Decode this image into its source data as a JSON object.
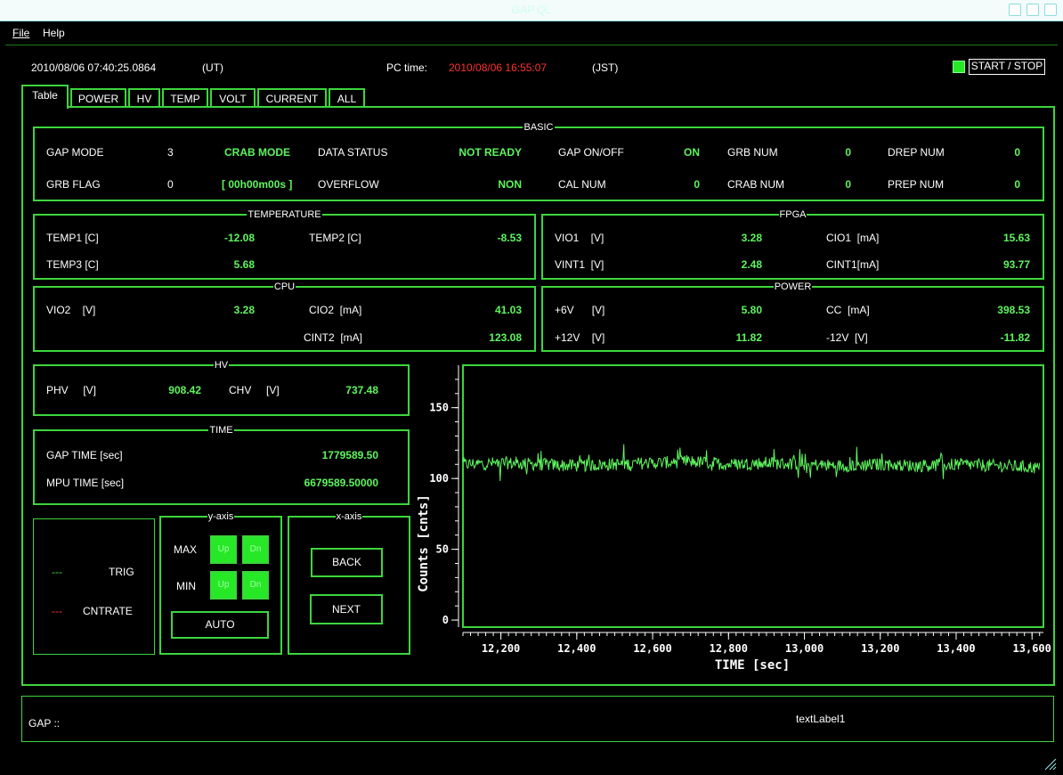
{
  "window": {
    "title": "GAP QL"
  },
  "menu": {
    "file": "File",
    "help": "Help"
  },
  "header": {
    "ut_time": "2010/08/06 07:40:25.0864",
    "ut_label": "(UT)",
    "pc_time_label": "PC time:",
    "pc_time": "2010/08/06 16:55:07",
    "jst_label": "(JST)",
    "start_stop": "START / STOP"
  },
  "tabs": [
    "Table",
    "POWER",
    "HV",
    "TEMP",
    "VOLT",
    "CURRENT",
    "ALL"
  ],
  "basic": {
    "title": "BASIC",
    "gap_mode_label": "GAP MODE",
    "gap_mode": "3",
    "crab_mode": "CRAB MODE",
    "data_status_label": "DATA STATUS",
    "data_status": "NOT READY",
    "gap_onoff_label": "GAP ON/OFF",
    "gap_onoff": "ON",
    "grb_num_label": "GRB NUM",
    "grb_num": "0",
    "drep_num_label": "DREP NUM",
    "drep_num": "0",
    "grb_flag_label": "GRB FLAG",
    "grb_flag": "0",
    "grb_time": "[ 00h00m00s ]",
    "overflow_label": "OVERFLOW",
    "overflow": "NON",
    "cal_num_label": "CAL NUM",
    "cal_num": "0",
    "crab_num_label": "CRAB NUM",
    "crab_num": "0",
    "prep_num_label": "PREP NUM",
    "prep_num": "0"
  },
  "temperature": {
    "title": "TEMPERATURE",
    "temp1_label": "TEMP1 [C]",
    "temp1": "-12.08",
    "temp2_label": "TEMP2 [C]",
    "temp2": "-8.53",
    "temp3_label": "TEMP3 [C]",
    "temp3": "5.68"
  },
  "fpga": {
    "title": "FPGA",
    "vio1_label": "VIO1    [V]",
    "vio1": "3.28",
    "cio1_label": "CIO1  [mA]",
    "cio1": "15.63",
    "vint1_label": "VINT1  [V]",
    "vint1": "2.48",
    "cint1_label": "CINT1[mA]",
    "cint1": "93.77"
  },
  "cpu": {
    "title": "CPU",
    "vio2_label": "VIO2    [V]",
    "vio2": "3.28",
    "cio2_label": "CIO2  [mA]",
    "cio2": "41.03",
    "cint2_label": "CINT2  [mA]",
    "cint2": "123.08"
  },
  "power": {
    "title": "POWER",
    "p6v_label": "+6V      [V]",
    "p6v": "5.80",
    "cc_label": "CC  [mA]",
    "cc": "398.53",
    "p12v_label": "+12V    [V]",
    "p12v": "11.82",
    "m12v_label": "-12V  [V]",
    "m12v": "-11.82"
  },
  "hv": {
    "title": "HV",
    "phv_label": "PHV     [V]",
    "phv": "908.42",
    "chv_label": "CHV     [V]",
    "chv": "737.48"
  },
  "time": {
    "title": "TIME",
    "gap_time_label": "GAP TIME  [sec]",
    "gap_time": "1779589.50",
    "mpu_time_label": "MPU TIME [sec]",
    "mpu_time": "6679589.50000"
  },
  "legend": {
    "trig_dash": "---",
    "trig": "TRIG",
    "cnt_dash": "---",
    "cntrate": "CNTRATE",
    "trig_color": "#3cd63c",
    "cnt_color": "#ff3030"
  },
  "yaxis_ctrl": {
    "title": "y-axis",
    "max_label": "MAX",
    "min_label": "MIN",
    "up": "Up",
    "dn": "Dn",
    "auto": "AUTO"
  },
  "xaxis_ctrl": {
    "title": "x-axis",
    "back": "BACK",
    "next": "NEXT"
  },
  "chart_data": {
    "type": "line",
    "xlabel": "TIME [sec]",
    "ylabel": "Counts [cnts]",
    "xlim": [
      12100,
      13630
    ],
    "ylim": [
      -5,
      180
    ],
    "xticks": [
      "12,200",
      "12,400",
      "12,600",
      "12,800",
      "13,000",
      "13,200",
      "13,400",
      "13,600"
    ],
    "yticks": [
      "0",
      "50",
      "100",
      "150"
    ],
    "series": [
      {
        "color": "#5ef55e",
        "x": [
          12100,
          12200,
          12300,
          12400,
          12500,
          12600,
          12700,
          12800,
          12900,
          13000,
          13100,
          13200,
          13300,
          13400,
          13500,
          13600,
          13620
        ],
        "y": [
          110,
          111,
          110,
          109,
          110,
          111,
          112,
          110,
          111,
          110,
          109,
          110,
          109,
          110,
          109,
          108,
          107
        ]
      }
    ]
  },
  "status": {
    "gap_label": "GAP ::",
    "text_label": "textLabel1"
  }
}
